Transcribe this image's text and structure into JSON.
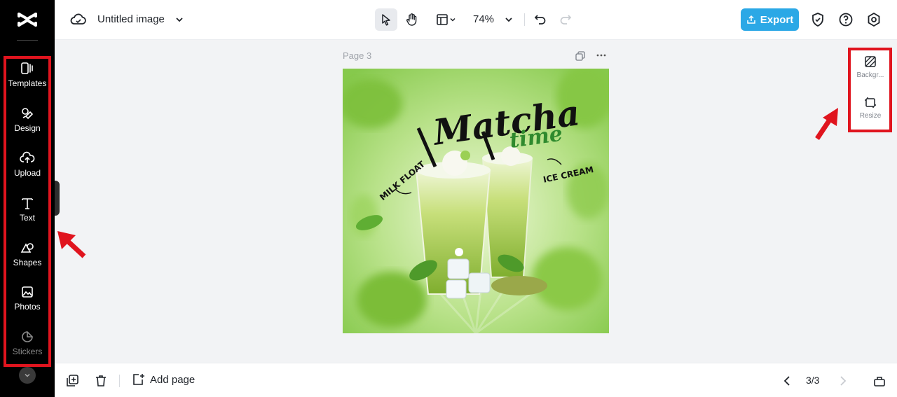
{
  "app": {
    "title": "Untitled image"
  },
  "sidebar": {
    "items": [
      {
        "label": "Templates",
        "icon": "templates-icon"
      },
      {
        "label": "Design",
        "icon": "design-icon"
      },
      {
        "label": "Upload",
        "icon": "upload-icon"
      },
      {
        "label": "Text",
        "icon": "text-icon"
      },
      {
        "label": "Shapes",
        "icon": "shapes-icon"
      },
      {
        "label": "Photos",
        "icon": "photos-icon"
      },
      {
        "label": "Stickers",
        "icon": "stickers-icon"
      }
    ]
  },
  "toolbar": {
    "zoom": "74%",
    "export_label": "Export"
  },
  "canvas": {
    "page_label": "Page 3",
    "artwork": {
      "title_main": "Matcha",
      "title_sub": "time",
      "label_left": "MILK FLOAT",
      "label_right": "ICE CREAM"
    }
  },
  "right_panel": {
    "items": [
      {
        "label": "Backgr...",
        "icon": "background-icon"
      },
      {
        "label": "Resize",
        "icon": "resize-icon"
      }
    ]
  },
  "bottom": {
    "add_page_label": "Add page",
    "page_counter": "3/3"
  },
  "colors": {
    "accent": "#2ba8e6",
    "annotation": "#e0141e",
    "sidebar_bg": "#000000",
    "matcha_green": "#8bc34a"
  }
}
